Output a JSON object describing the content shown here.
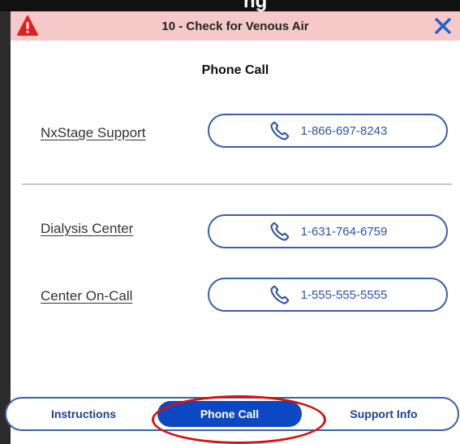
{
  "dialog": {
    "title": "10 - Check for Venous Air",
    "header_clipped_text": "ng"
  },
  "section_title": "Phone Call",
  "contacts": [
    {
      "name": "NxStage Support",
      "phone": "1-866-697-8243"
    },
    {
      "name": "Dialysis Center",
      "phone": "1-631-764-6759"
    },
    {
      "name": "Center On-Call",
      "phone": "1-555-555-5555"
    }
  ],
  "tabs": [
    {
      "label": "Instructions",
      "active": false
    },
    {
      "label": "Phone Call",
      "active": true
    },
    {
      "label": "Support Info",
      "active": false
    }
  ],
  "icons": {
    "warning": "warning-triangle-icon",
    "close": "close-x-icon",
    "phone": "phone-handset-icon"
  },
  "colors": {
    "titlebar_bg": "#f6c9c9",
    "warning_red": "#e02020",
    "close_blue": "#1f5fd0",
    "accent_blue": "#0d48c3",
    "button_border": "#3a5fb0",
    "highlight_ring": "#d91010"
  }
}
